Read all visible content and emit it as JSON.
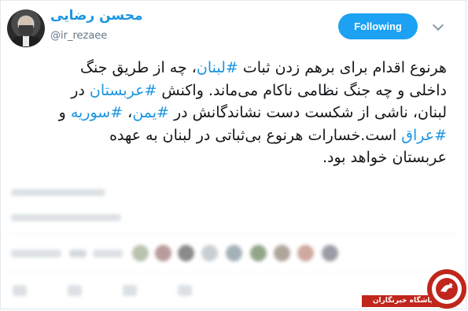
{
  "tweet": {
    "display_name": "محسن رضایی",
    "handle": "@ir_rezaee",
    "follow_label": "Following",
    "text_lines": [
      [
        {
          "t": "هرنوع اقدام برای برهم زدن ثبات ",
          "tag": false
        },
        {
          "t": "#لبنان",
          "tag": true
        },
        {
          "t": "، چه از طریق جنگ",
          "tag": false
        }
      ],
      [
        {
          "t": "داخلی و چه جنگ نظامی ناکام می‌ماند. واکنش ",
          "tag": false
        },
        {
          "t": "#عربستان",
          "tag": true
        },
        {
          "t": " در",
          "tag": false
        }
      ],
      [
        {
          "t": "لبنان، ناشی از شکست دست نشاندگانش در ",
          "tag": false
        },
        {
          "t": "#یمن",
          "tag": true
        },
        {
          "t": "، ",
          "tag": false
        },
        {
          "t": "#سوریه",
          "tag": true
        },
        {
          "t": " و",
          "tag": false
        }
      ],
      [
        {
          "t": "#عراق",
          "tag": true
        },
        {
          "t": " است.خسارات هرنوع بی‌ثباتی در لبنان به عهده",
          "tag": false
        }
      ],
      [
        {
          "t": "عربستان خواهد بود.",
          "tag": false
        }
      ]
    ]
  },
  "watermark": {
    "label": "باشگاه خبرنگاران"
  },
  "icons": {
    "more": "chevron-down-icon",
    "watermark_seal": "seal-icon"
  },
  "colors": {
    "link": "#1b95e0",
    "follow_bg": "#1da1f2",
    "text": "#14171a",
    "muted": "#657786",
    "watermark": "#c0261b"
  }
}
